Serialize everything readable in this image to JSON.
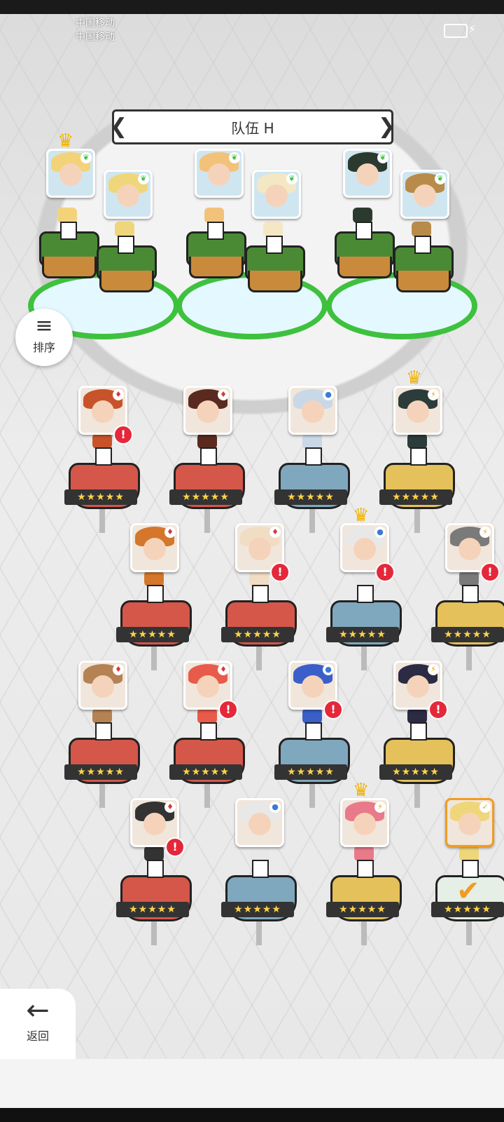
{
  "status": {
    "carrier1": "中国移动",
    "carrier2": "中国移动"
  },
  "team": {
    "title": "队伍 H",
    "prev": "❮",
    "next": "❯"
  },
  "sort": {
    "label": "排序",
    "icon": "sort-icon"
  },
  "back": {
    "label": "返回",
    "icon": "arrow-left-icon"
  },
  "colors": {
    "fire": "#d4574a",
    "water": "#7fa8bf",
    "light": "#e4c15a",
    "accent": "#f29c1f",
    "warn": "#e4283a",
    "grass": "#3ec13e"
  },
  "stars": "★★★★★",
  "team_heroes": [
    {
      "hair": "#f3d37a",
      "elem": "grass",
      "crown": true
    },
    {
      "hair": "#f0d67a",
      "elem": "grass",
      "crown": false
    },
    {
      "hair": "#f2c27a",
      "elem": "grass",
      "crown": false
    },
    {
      "hair": "#f4e7c4",
      "elem": "grass",
      "crown": false
    },
    {
      "hair": "#2b3a2f",
      "elem": "grass",
      "crown": false
    },
    {
      "hair": "#b98b4a",
      "elem": "grass",
      "crown": false
    }
  ],
  "heroes": [
    {
      "hair": "#c8532a",
      "type": "fire",
      "elem": "♦",
      "warn": true,
      "crown": false
    },
    {
      "hair": "#5a2a20",
      "type": "fire",
      "elem": "♦",
      "warn": false,
      "crown": false
    },
    {
      "hair": "#c9d8e6",
      "type": "water",
      "elem": "●",
      "warn": false,
      "crown": false
    },
    {
      "hair": "#2c3c3a",
      "type": "light",
      "elem": "⚡",
      "warn": false,
      "crown": true
    },
    {
      "hair": "#d4772a",
      "type": "fire",
      "elem": "♦",
      "warn": false,
      "crown": false
    },
    {
      "hair": "#f1dcc4",
      "type": "fire",
      "elem": "♦",
      "warn": true,
      "crown": false
    },
    {
      "hair": "#e8e8e8",
      "type": "water",
      "elem": "●",
      "warn": true,
      "crown": true
    },
    {
      "hair": "#7a7a7a",
      "type": "light",
      "elem": "⚡",
      "warn": true,
      "crown": false
    },
    {
      "hair": "#b58254",
      "type": "fire",
      "elem": "♦",
      "warn": false,
      "crown": false
    },
    {
      "hair": "#e85a4a",
      "type": "fire",
      "elem": "♦",
      "warn": true,
      "crown": false
    },
    {
      "hair": "#3a5fc9",
      "type": "water",
      "elem": "●",
      "warn": true,
      "crown": false
    },
    {
      "hair": "#2b2b44",
      "type": "light",
      "elem": "⚡",
      "warn": true,
      "crown": false
    },
    {
      "hair": "#333333",
      "type": "fire",
      "elem": "♦",
      "warn": true,
      "crown": false
    },
    {
      "hair": "#e8e8e8",
      "type": "water",
      "elem": "●",
      "warn": false,
      "crown": false
    },
    {
      "hair": "#e87a8a",
      "type": "light",
      "elem": "⚡",
      "warn": false,
      "crown": true
    },
    {
      "hair": "#f0d67a",
      "type": "selected",
      "elem": "✓",
      "warn": false,
      "crown": false,
      "selected": true
    }
  ]
}
